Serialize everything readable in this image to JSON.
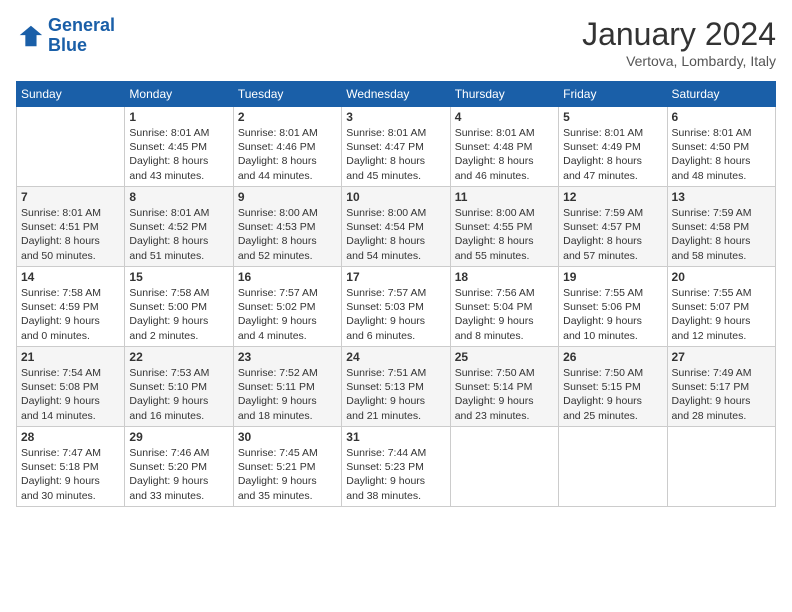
{
  "logo": {
    "line1": "General",
    "line2": "Blue"
  },
  "title": "January 2024",
  "subtitle": "Vertova, Lombardy, Italy",
  "days_of_week": [
    "Sunday",
    "Monday",
    "Tuesday",
    "Wednesday",
    "Thursday",
    "Friday",
    "Saturday"
  ],
  "weeks": [
    [
      {
        "day": "",
        "info": ""
      },
      {
        "day": "1",
        "info": "Sunrise: 8:01 AM\nSunset: 4:45 PM\nDaylight: 8 hours\nand 43 minutes."
      },
      {
        "day": "2",
        "info": "Sunrise: 8:01 AM\nSunset: 4:46 PM\nDaylight: 8 hours\nand 44 minutes."
      },
      {
        "day": "3",
        "info": "Sunrise: 8:01 AM\nSunset: 4:47 PM\nDaylight: 8 hours\nand 45 minutes."
      },
      {
        "day": "4",
        "info": "Sunrise: 8:01 AM\nSunset: 4:48 PM\nDaylight: 8 hours\nand 46 minutes."
      },
      {
        "day": "5",
        "info": "Sunrise: 8:01 AM\nSunset: 4:49 PM\nDaylight: 8 hours\nand 47 minutes."
      },
      {
        "day": "6",
        "info": "Sunrise: 8:01 AM\nSunset: 4:50 PM\nDaylight: 8 hours\nand 48 minutes."
      }
    ],
    [
      {
        "day": "7",
        "info": "Sunrise: 8:01 AM\nSunset: 4:51 PM\nDaylight: 8 hours\nand 50 minutes."
      },
      {
        "day": "8",
        "info": "Sunrise: 8:01 AM\nSunset: 4:52 PM\nDaylight: 8 hours\nand 51 minutes."
      },
      {
        "day": "9",
        "info": "Sunrise: 8:00 AM\nSunset: 4:53 PM\nDaylight: 8 hours\nand 52 minutes."
      },
      {
        "day": "10",
        "info": "Sunrise: 8:00 AM\nSunset: 4:54 PM\nDaylight: 8 hours\nand 54 minutes."
      },
      {
        "day": "11",
        "info": "Sunrise: 8:00 AM\nSunset: 4:55 PM\nDaylight: 8 hours\nand 55 minutes."
      },
      {
        "day": "12",
        "info": "Sunrise: 7:59 AM\nSunset: 4:57 PM\nDaylight: 8 hours\nand 57 minutes."
      },
      {
        "day": "13",
        "info": "Sunrise: 7:59 AM\nSunset: 4:58 PM\nDaylight: 8 hours\nand 58 minutes."
      }
    ],
    [
      {
        "day": "14",
        "info": "Sunrise: 7:58 AM\nSunset: 4:59 PM\nDaylight: 9 hours\nand 0 minutes."
      },
      {
        "day": "15",
        "info": "Sunrise: 7:58 AM\nSunset: 5:00 PM\nDaylight: 9 hours\nand 2 minutes."
      },
      {
        "day": "16",
        "info": "Sunrise: 7:57 AM\nSunset: 5:02 PM\nDaylight: 9 hours\nand 4 minutes."
      },
      {
        "day": "17",
        "info": "Sunrise: 7:57 AM\nSunset: 5:03 PM\nDaylight: 9 hours\nand 6 minutes."
      },
      {
        "day": "18",
        "info": "Sunrise: 7:56 AM\nSunset: 5:04 PM\nDaylight: 9 hours\nand 8 minutes."
      },
      {
        "day": "19",
        "info": "Sunrise: 7:55 AM\nSunset: 5:06 PM\nDaylight: 9 hours\nand 10 minutes."
      },
      {
        "day": "20",
        "info": "Sunrise: 7:55 AM\nSunset: 5:07 PM\nDaylight: 9 hours\nand 12 minutes."
      }
    ],
    [
      {
        "day": "21",
        "info": "Sunrise: 7:54 AM\nSunset: 5:08 PM\nDaylight: 9 hours\nand 14 minutes."
      },
      {
        "day": "22",
        "info": "Sunrise: 7:53 AM\nSunset: 5:10 PM\nDaylight: 9 hours\nand 16 minutes."
      },
      {
        "day": "23",
        "info": "Sunrise: 7:52 AM\nSunset: 5:11 PM\nDaylight: 9 hours\nand 18 minutes."
      },
      {
        "day": "24",
        "info": "Sunrise: 7:51 AM\nSunset: 5:13 PM\nDaylight: 9 hours\nand 21 minutes."
      },
      {
        "day": "25",
        "info": "Sunrise: 7:50 AM\nSunset: 5:14 PM\nDaylight: 9 hours\nand 23 minutes."
      },
      {
        "day": "26",
        "info": "Sunrise: 7:50 AM\nSunset: 5:15 PM\nDaylight: 9 hours\nand 25 minutes."
      },
      {
        "day": "27",
        "info": "Sunrise: 7:49 AM\nSunset: 5:17 PM\nDaylight: 9 hours\nand 28 minutes."
      }
    ],
    [
      {
        "day": "28",
        "info": "Sunrise: 7:47 AM\nSunset: 5:18 PM\nDaylight: 9 hours\nand 30 minutes."
      },
      {
        "day": "29",
        "info": "Sunrise: 7:46 AM\nSunset: 5:20 PM\nDaylight: 9 hours\nand 33 minutes."
      },
      {
        "day": "30",
        "info": "Sunrise: 7:45 AM\nSunset: 5:21 PM\nDaylight: 9 hours\nand 35 minutes."
      },
      {
        "day": "31",
        "info": "Sunrise: 7:44 AM\nSunset: 5:23 PM\nDaylight: 9 hours\nand 38 minutes."
      },
      {
        "day": "",
        "info": ""
      },
      {
        "day": "",
        "info": ""
      },
      {
        "day": "",
        "info": ""
      }
    ]
  ]
}
